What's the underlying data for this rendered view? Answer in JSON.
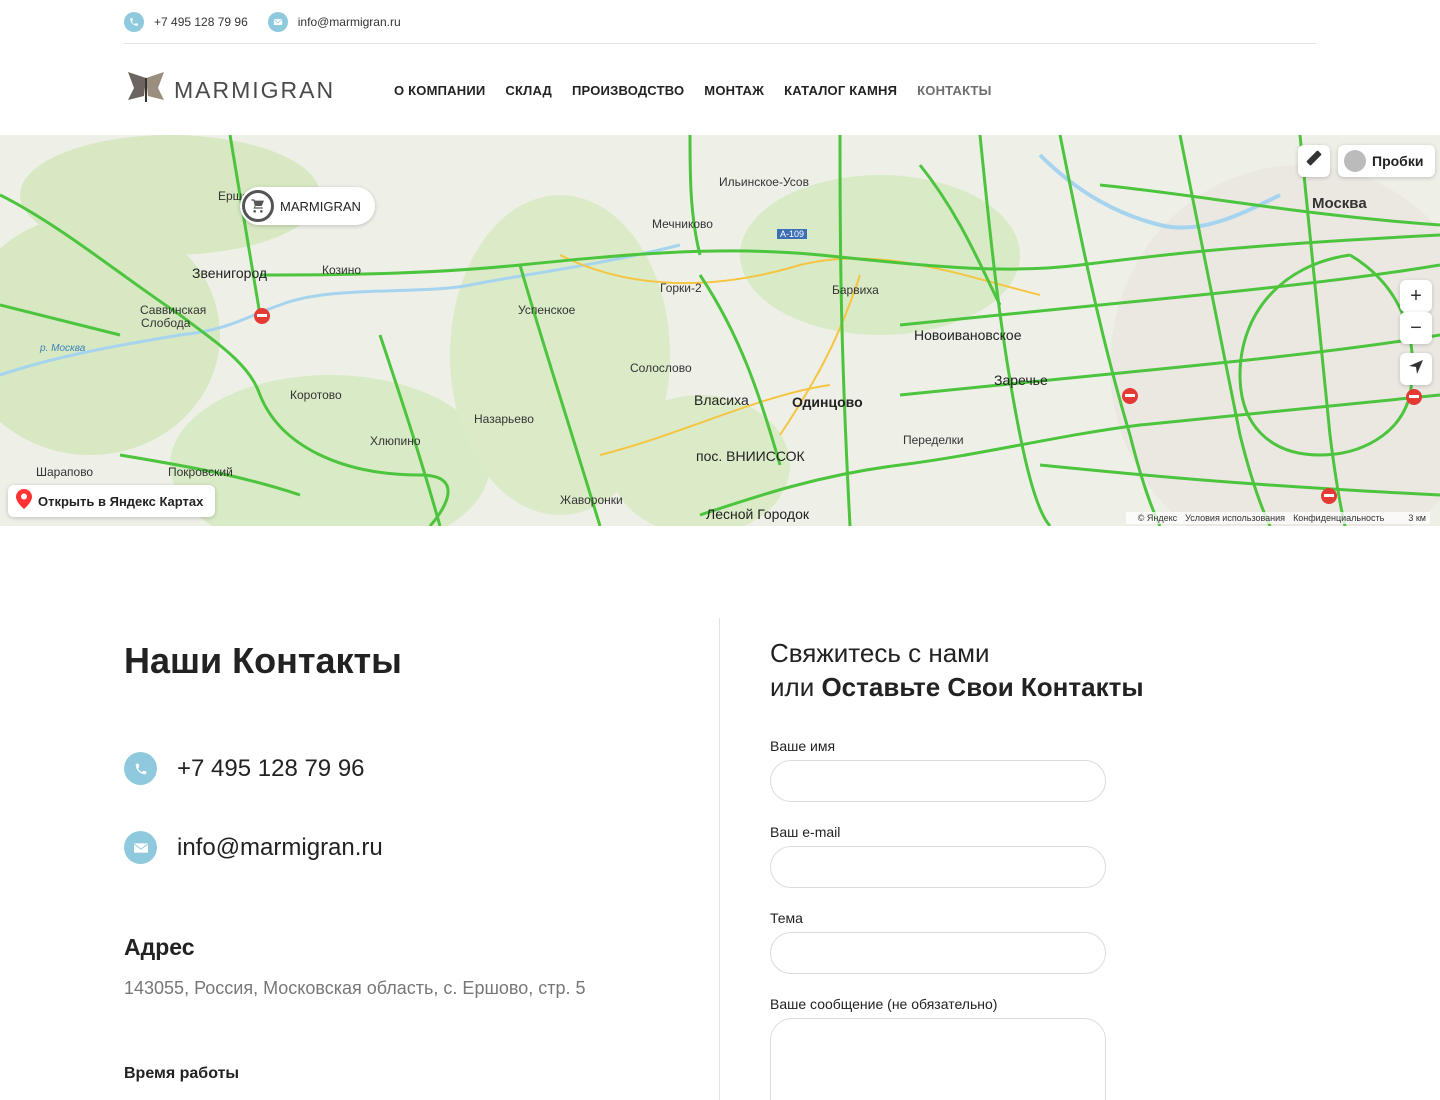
{
  "topbar": {
    "phone": "+7 495 128 79 96",
    "email": "info@marmigran.ru"
  },
  "header": {
    "logo_text": "MARMIGRAN",
    "nav": [
      {
        "label": "О КОМПАНИИ"
      },
      {
        "label": "СКЛАД"
      },
      {
        "label": "ПРОИЗВОДСТВО"
      },
      {
        "label": "МОНТАЖ"
      },
      {
        "label": "КАТАЛОГ КАМНЯ"
      },
      {
        "label": "КОНТАКТЫ"
      }
    ]
  },
  "map": {
    "marker_label": "MARMIGRAN",
    "open_label": "Открыть в Яндекс Картах",
    "traffic_label": "Пробки",
    "zoom_in": "+",
    "zoom_out": "−",
    "footer": {
      "copyright": "© Яндекс",
      "terms": "Условия использования",
      "privacy": "Конфиденциальность",
      "scale": "3 км"
    },
    "labels": {
      "ilinskoe": "Ильинское-Усов",
      "mechnikovo": "Мечниково",
      "gorki2": "Горки-2",
      "zvenigorod": "Звенигород",
      "savvinskaya": "Саввинская",
      "sloboda": "Слобода",
      "uspenskoe": "Успенское",
      "solोslovo": "Солослово",
      "vlasikha": "Власиха",
      "odintsovo": "Одинцово",
      "vniissok": "пос. ВНИИССОК",
      "nazarevo": "Назарьево",
      "novoivanovskoe": "Новоивановское",
      "zarechye": "Заречье",
      "moskva": "Москва",
      "sharapovo": "Шарапово",
      "pokrovsky": "Покровский",
      "zhavoronki": "Жаворонки",
      "lesnoy": "Лесной Городок",
      "barvikha": "Барвиха",
      "a109": "А-109",
      "peredelki": "Переделки",
      "kozino": "Козино",
      "korotovo": "Коротово",
      "khlyupino": "Хлюпино",
      "ershovo": "Ершово",
      "reka_moskva": "р. Москва"
    },
    "colors": {
      "road_green": "#4cc43d",
      "road_yellow": "#f5c542",
      "road_red": "#e53935",
      "forest": "#d7e8c3"
    }
  },
  "contacts": {
    "title": "Наши Контакты",
    "phone": "+7 495 128 79 96",
    "email": "info@marmigran.ru",
    "address_title": "Адрес",
    "address": "143055, Россия, Московская область, с. Ершово, стр. 5",
    "hours_title": "Время работы"
  },
  "form": {
    "title_line1": "Свяжитесь с нами",
    "title_line2_prefix": "или ",
    "title_line2_bold": "Оставьте Свои Контакты",
    "fields": [
      {
        "label": "Ваше имя",
        "value": ""
      },
      {
        "label": "Ваш e-mail",
        "value": ""
      },
      {
        "label": "Тема",
        "value": ""
      },
      {
        "label": "Ваше сообщение (не обязательно)",
        "value": ""
      }
    ]
  },
  "colors": {
    "accent": "#8ec9dd",
    "nav_active": "#6d6d6d",
    "muted_text": "#777777"
  }
}
